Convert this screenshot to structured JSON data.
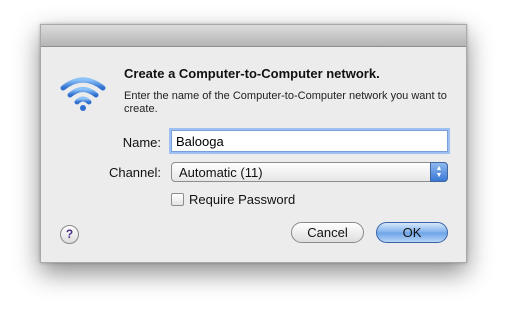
{
  "dialog": {
    "heading": "Create a Computer-to-Computer network.",
    "description": "Enter the name of the Computer-to-Computer network you want to create.",
    "name_label": "Name:",
    "name_value": "Balooga",
    "channel_label": "Channel:",
    "channel_value": "Automatic (11)",
    "require_password_label": "Require Password",
    "require_password_checked": false,
    "help_label": "?",
    "cancel_label": "Cancel",
    "ok_label": "OK"
  },
  "colors": {
    "dialog_bg": "#ececec",
    "default_button": "#6aa2e6",
    "wifi_icon": "#3a7bd5"
  },
  "icons": {
    "wifi": "wifi-icon",
    "help": "help-icon",
    "select_arrows": "updown-arrows-icon"
  }
}
